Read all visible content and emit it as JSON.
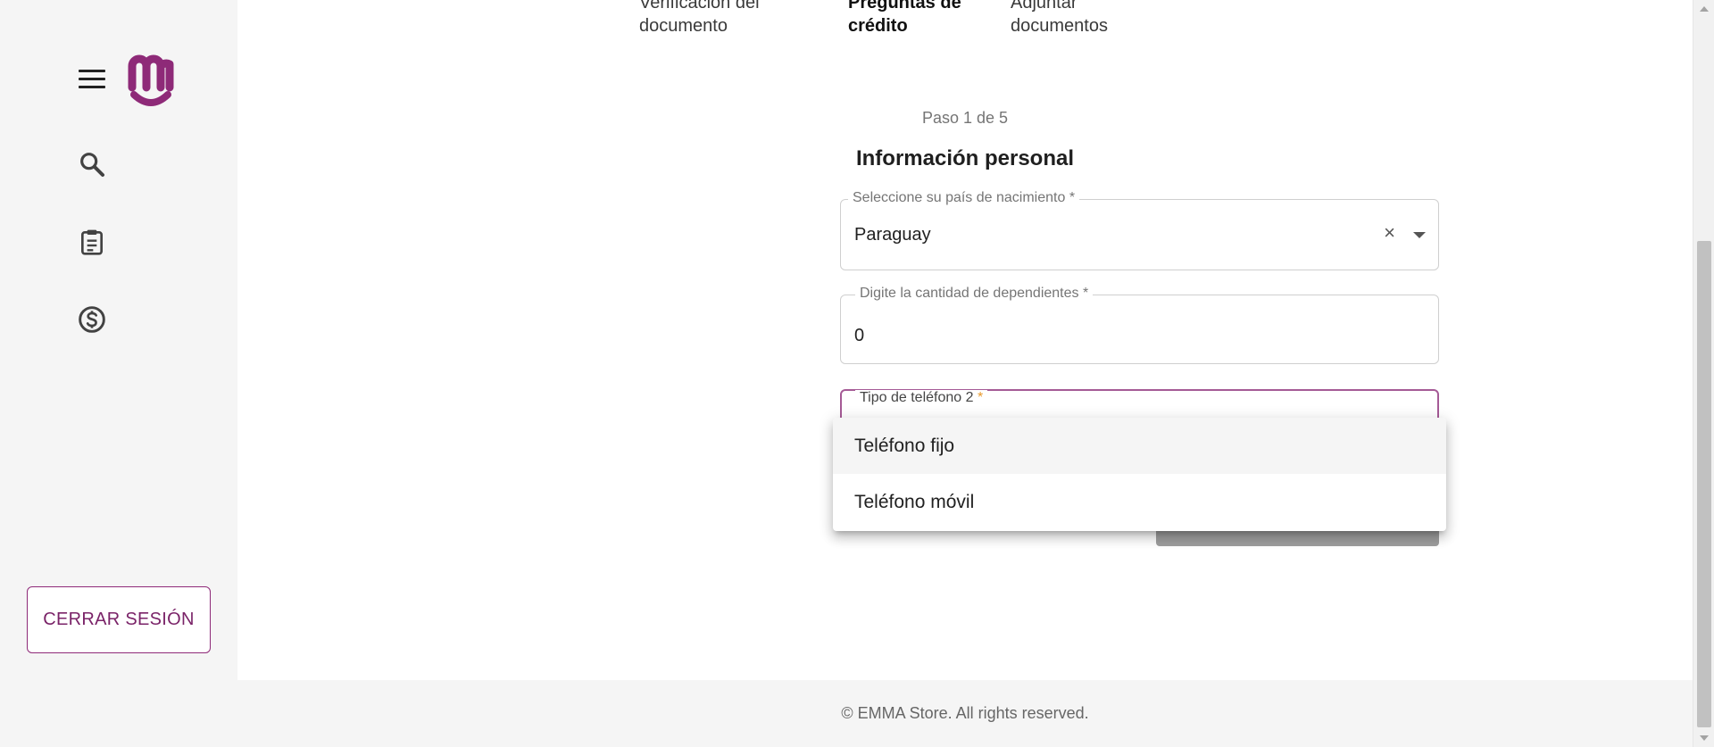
{
  "stepper": {
    "step1_line1": "Verificación del",
    "step1_line2": "documento",
    "step2_line1": "Preguntas de",
    "step2_line2": "crédito",
    "step3_line1": "Adjuntar",
    "step3_line2": "documentos"
  },
  "form": {
    "step_count": "Paso 1 de 5",
    "title": "Información personal",
    "country_label": "Seleccione su país de nacimiento *",
    "country_value": "Paraguay",
    "dependents_label": "Digite la cantidad de dependientes *",
    "dependents_value": "0",
    "phone_type_label": "Tipo de teléfono 2",
    "phone_type_required": "*",
    "clear_glyph": "×"
  },
  "dropdown": {
    "options": [
      "Teléfono fijo",
      "Teléfono móvil"
    ],
    "highlighted_index": 0
  },
  "sidebar": {
    "logout_label": "CERRAR SESIÓN",
    "icons": [
      "menu-icon",
      "logo-icon",
      "search-icon",
      "clipboard-icon",
      "dollar-icon"
    ]
  },
  "footer": {
    "text": "© EMMA Store. All rights reserved."
  },
  "colors": {
    "brand": "#8e2a78",
    "focus_border": "#a55a96",
    "required_star": "#e89a2c"
  }
}
